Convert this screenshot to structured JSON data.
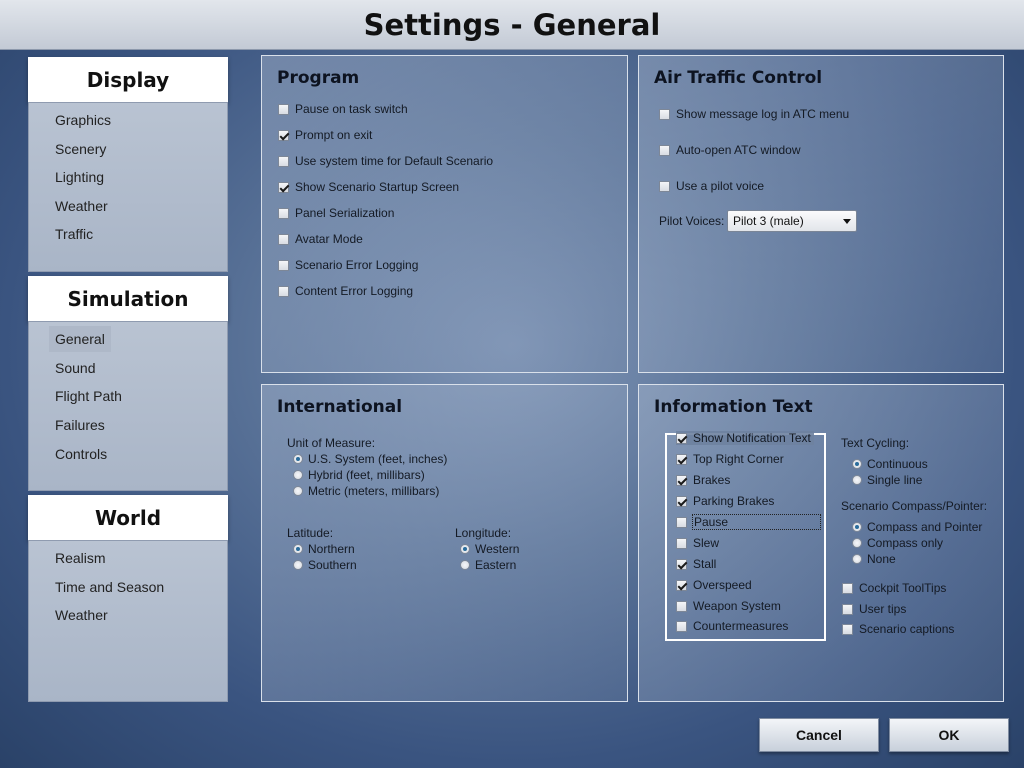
{
  "title": "Settings - General",
  "sidebar": {
    "display": {
      "header": "Display",
      "items": [
        "Graphics",
        "Scenery",
        "Lighting",
        "Weather",
        "Traffic"
      ]
    },
    "simulation": {
      "header": "Simulation",
      "items": [
        "General",
        "Sound",
        "Flight Path",
        "Failures",
        "Controls"
      ],
      "active": "General"
    },
    "world": {
      "header": "World",
      "items": [
        "Realism",
        "Time and Season",
        "Weather"
      ]
    }
  },
  "program": {
    "title": "Program",
    "options": [
      {
        "label": "Pause on task switch",
        "checked": false
      },
      {
        "label": "Prompt on exit",
        "checked": true
      },
      {
        "label": "Use system time for Default Scenario",
        "checked": false
      },
      {
        "label": "Show Scenario Startup Screen",
        "checked": true
      },
      {
        "label": "Panel Serialization",
        "checked": false
      },
      {
        "label": "Avatar Mode",
        "checked": false
      },
      {
        "label": "Scenario Error Logging",
        "checked": false
      },
      {
        "label": "Content Error Logging",
        "checked": false
      }
    ]
  },
  "atc": {
    "title": "Air Traffic Control",
    "options": [
      {
        "label": "Show message log in ATC menu",
        "checked": false
      },
      {
        "label": "Auto-open ATC window",
        "checked": false
      },
      {
        "label": "Use a pilot voice",
        "checked": false
      }
    ],
    "pilot_voices_label": "Pilot Voices:",
    "pilot_voice_selected": "Pilot 3 (male)"
  },
  "international": {
    "title": "International",
    "unit_label": "Unit of Measure:",
    "units": [
      {
        "label": "U.S. System (feet, inches)",
        "checked": true
      },
      {
        "label": "Hybrid (feet, millibars)",
        "checked": false
      },
      {
        "label": "Metric (meters, millibars)",
        "checked": false
      }
    ],
    "latitude_label": "Latitude:",
    "latitude": [
      {
        "label": "Northern",
        "checked": true
      },
      {
        "label": "Southern",
        "checked": false
      }
    ],
    "longitude_label": "Longitude:",
    "longitude": [
      {
        "label": "Western",
        "checked": true
      },
      {
        "label": "Eastern",
        "checked": false
      }
    ]
  },
  "info_text": {
    "title": "Information Text",
    "notifications": [
      {
        "label": "Show Notification Text",
        "checked": true
      },
      {
        "label": "Top Right Corner",
        "checked": true
      },
      {
        "label": "Brakes",
        "checked": true
      },
      {
        "label": "Parking Brakes",
        "checked": true
      },
      {
        "label": "Pause",
        "checked": false
      },
      {
        "label": "Slew",
        "checked": false
      },
      {
        "label": "Stall",
        "checked": true
      },
      {
        "label": "Overspeed",
        "checked": true
      },
      {
        "label": "Weapon System",
        "checked": false
      },
      {
        "label": "Countermeasures",
        "checked": false
      }
    ],
    "text_cycling_label": "Text Cycling:",
    "text_cycling": [
      {
        "label": "Continuous",
        "checked": true
      },
      {
        "label": "Single line",
        "checked": false
      }
    ],
    "compass_label": "Scenario Compass/Pointer:",
    "compass": [
      {
        "label": "Compass and Pointer",
        "checked": true
      },
      {
        "label": "Compass only",
        "checked": false
      },
      {
        "label": "None",
        "checked": false
      }
    ],
    "extras": [
      {
        "label": "Cockpit ToolTips",
        "checked": false
      },
      {
        "label": "User tips",
        "checked": false
      },
      {
        "label": "Scenario captions",
        "checked": false
      }
    ]
  },
  "buttons": {
    "cancel": "Cancel",
    "ok": "OK"
  }
}
